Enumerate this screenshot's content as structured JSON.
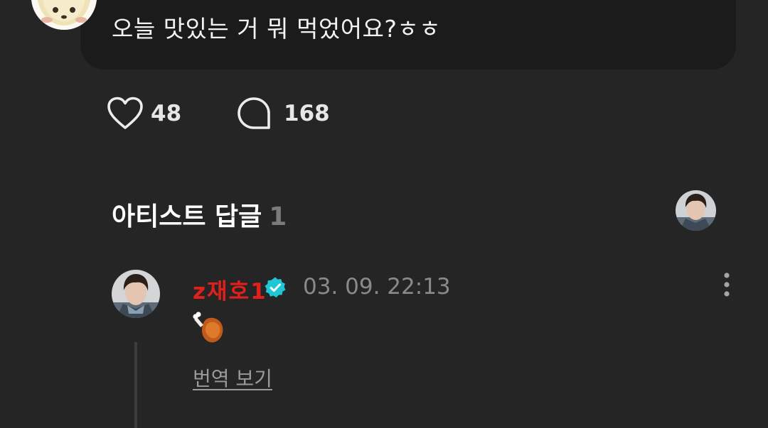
{
  "post": {
    "text": "오늘 맛있는 거 뭐 먹었어요?ㅎㅎ",
    "author_avatar": "fan-avatar-illustration"
  },
  "actions": {
    "like_icon": "heart-outline-icon",
    "like_count": "48",
    "comment_icon": "speech-bubble-icon",
    "comment_count": "168"
  },
  "artist_replies": {
    "title": "아티스트 답글",
    "count": "1",
    "header_avatar": "artist-avatar"
  },
  "reply": {
    "author": "z재호1",
    "verified_icon": "verified-badge-icon",
    "timestamp": "03. 09. 22:13",
    "content": "🍗",
    "translate_label": "번역 보기",
    "more_icon": "more-vertical-icon"
  },
  "colors": {
    "background": "#252525",
    "bubble": "#1b1b1b",
    "author_name": "#e0201d",
    "verified": "#1ec6d6",
    "muted_text": "#8a8a8a"
  }
}
